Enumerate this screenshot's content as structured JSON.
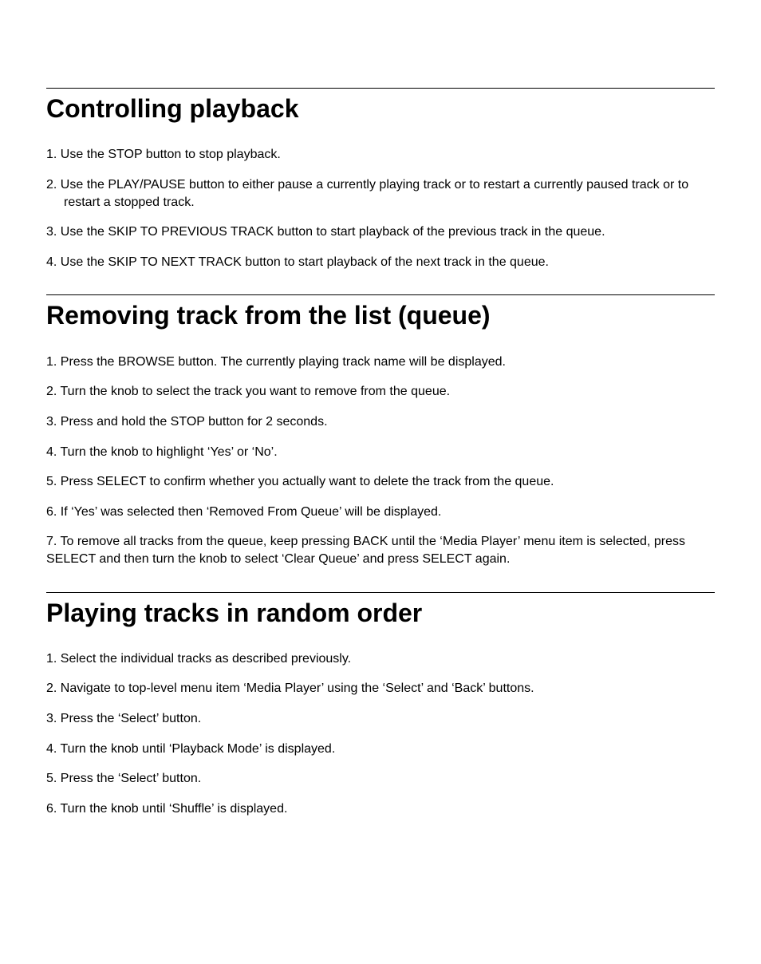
{
  "sections": [
    {
      "heading": "Controlling playback",
      "steps": [
        "1. Use the STOP button to stop playback.",
        "2. Use the PLAY/PAUSE button to either pause a currently playing track or to restart a currently paused track or to restart a stopped track.",
        "3. Use the SKIP TO PREVIOUS TRACK button to start playback of the previous track in the queue.",
        "4. Use the SKIP TO NEXT TRACK button to start playback of the next track in the queue."
      ]
    },
    {
      "heading": "Removing track from the list (queue)",
      "steps": [
        "1. Press the BROWSE button. The currently playing track name will be displayed.",
        "2. Turn the knob to select the track you want to remove from the queue.",
        "3. Press and hold the STOP button for 2 seconds.",
        "4. Turn the knob to highlight ‘Yes’ or ‘No’.",
        "5. Press SELECT to confirm whether you actually want to delete the track from the queue.",
        "6. If ‘Yes’ was selected then ‘Removed From Queue’ will be displayed."
      ],
      "extra": "7. To remove all tracks from the queue, keep pressing BACK until the ‘Media Player’ menu item is selected, press SELECT and then turn the knob to select ‘Clear Queue’ and press SELECT again."
    },
    {
      "heading": "Playing tracks in random order",
      "steps": [
        "1. Select the individual tracks as described previously.",
        "2. Navigate to top-level menu item ‘Media Player’ using the ‘Select’ and ‘Back’ buttons.",
        "3. Press the ‘Select’ button.",
        "4. Turn the knob until ‘Playback Mode’ is displayed.",
        "5. Press the ‘Select’ button.",
        "6. Turn the knob until ‘Shuffle’ is displayed."
      ]
    }
  ]
}
